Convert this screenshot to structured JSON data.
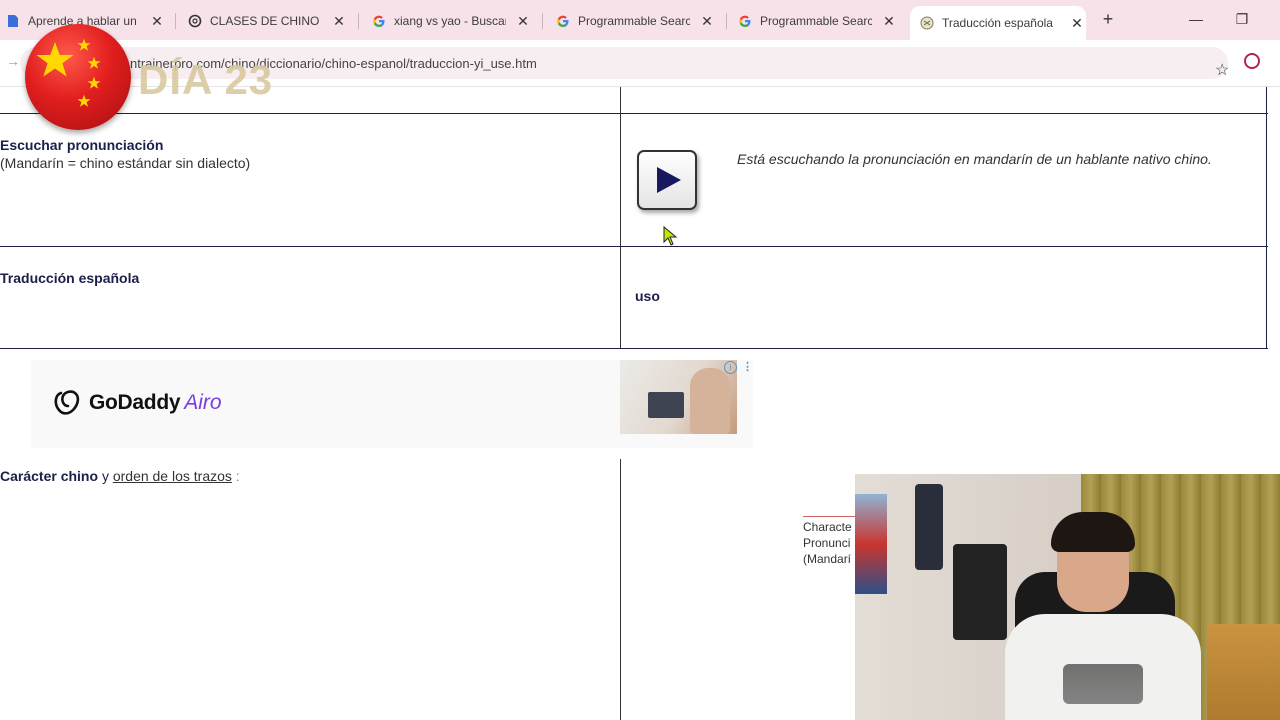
{
  "browser": {
    "tabs": [
      {
        "title": "Aprende a hablar un",
        "favicon": "doc-icon",
        "active": false
      },
      {
        "title": "CLASES DE CHINO 🇨🇳",
        "favicon": "openai-icon",
        "active": false
      },
      {
        "title": "xiang vs yao - Buscar",
        "favicon": "google-icon",
        "active": false
      },
      {
        "title": "Programmable Search",
        "favicon": "google-icon",
        "active": false
      },
      {
        "title": "Programmable Search",
        "favicon": "google-icon",
        "active": false
      },
      {
        "title": "Traducción española",
        "favicon": "site-icon",
        "active": true
      }
    ],
    "url": "ntrainerpro.com/chino/diccionario/chino-espanol/traduccion-yi_use.htm",
    "close_glyph": "✕",
    "new_tab_glyph": "+",
    "minimize_glyph": "—",
    "restore_glyph": "❐",
    "star_glyph": "☆",
    "forward_glyph": "→"
  },
  "overlay": {
    "day_label": "DÍA 23"
  },
  "page": {
    "pronunciation": {
      "label": "Escuchar pronunciación",
      "sublabel": "(Mandarín = chino estándar sin dialecto)",
      "note": "Está escuchando la pronunciación en mandarín de un hablante nativo chino."
    },
    "translation": {
      "label": "Traducción española",
      "value": "uso"
    },
    "ad": {
      "brand": "GoDaddy",
      "product": "Airo",
      "info_glyph": "i",
      "menu_glyph": "⋮"
    },
    "character": {
      "label_bold": "Carácter chino",
      "connector": "y",
      "link": "orden de los trazos",
      "colon": ":",
      "info_lines": [
        "Characte",
        "Pronunci",
        "(Mandarí"
      ]
    }
  },
  "colors": {
    "tabbar": "#f8e2ea",
    "heading": "#1b1f4a",
    "accent_purple": "#7a3be0",
    "flag_red": "#e11e1e",
    "flag_star": "#ffd800"
  }
}
